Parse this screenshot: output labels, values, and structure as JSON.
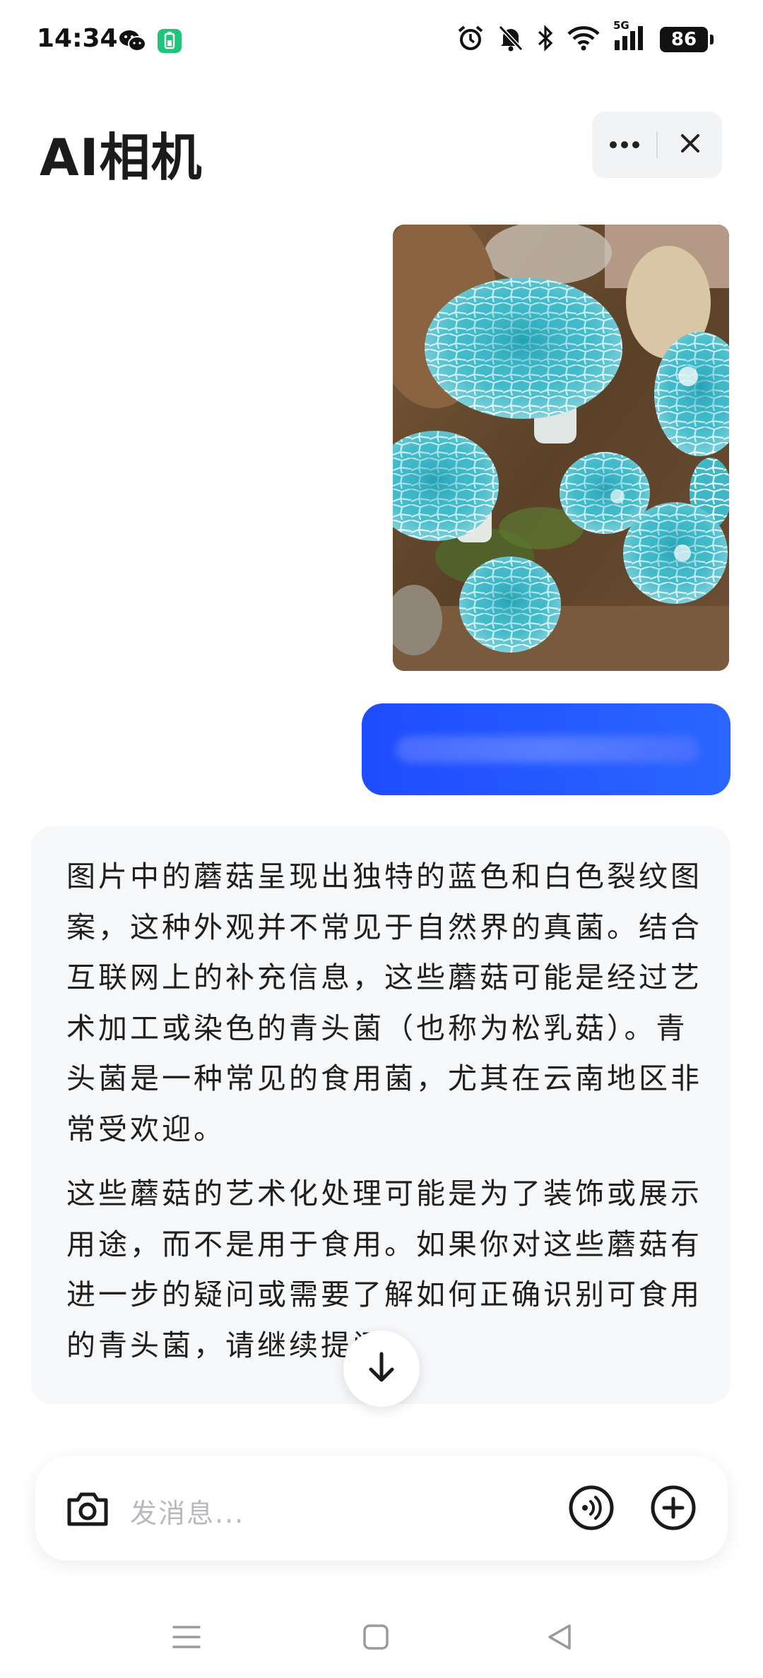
{
  "status_bar": {
    "time": "14:34",
    "network": "5G",
    "battery": "86",
    "icons": [
      "wechat-icon",
      "battery-saver-icon",
      "alarm-icon",
      "mute-icon",
      "bluetooth-icon",
      "wifi-icon",
      "signal-icon"
    ]
  },
  "header": {
    "title": "AI相机",
    "more_icon": "more-dots-icon",
    "close_icon": "close-icon"
  },
  "chat": {
    "user_photo": {
      "subject": "blue mushrooms"
    },
    "user_message": {
      "text": "",
      "blurred": true
    },
    "ai_response": {
      "paragraphs": [
        "图片中的蘑菇呈现出独特的蓝色和白色裂纹图案，这种外观并不常见于自然界的真菌。结合互联网上的补充信息，这些蘑菇可能是经过艺术加工或染色的青头菌（也称为松乳菇）。青头菌是一种常见的食用菌，尤其在云南地区非常受欢迎。",
        "这些蘑菇的艺术化处理可能是为了装饰或展示用途，而不是用于食用。如果你对这些蘑菇有进一步的疑问或需要了解如何正确识别可食用的青头菌，请继续提问。"
      ]
    },
    "scroll_down_icon": "arrow-down-icon"
  },
  "input": {
    "placeholder": "发消息...",
    "camera_icon": "camera-icon",
    "voice_icon": "voice-call-icon",
    "plus_icon": "plus-icon"
  },
  "colors": {
    "accent": "#2a5cff",
    "card_bg": "#f7f8fa",
    "text": "#1f1f1f",
    "placeholder": "#b8b9bd"
  }
}
